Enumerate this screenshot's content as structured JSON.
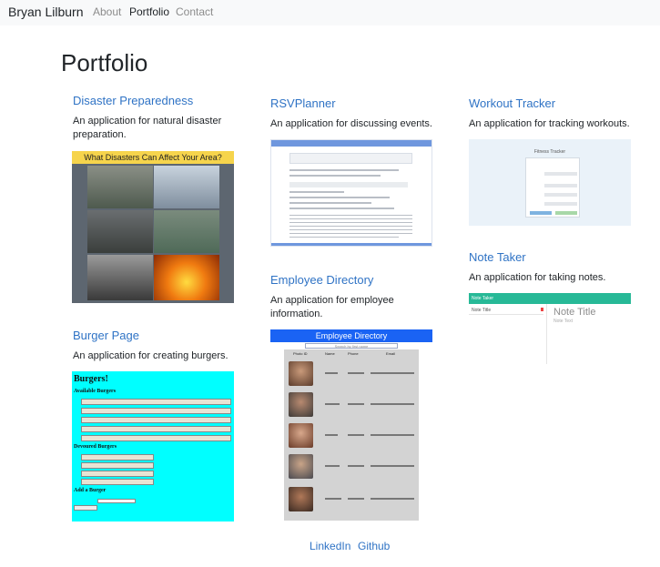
{
  "navbar": {
    "brand": "Bryan Lilburn",
    "links": [
      "About",
      "Portfolio",
      "Contact"
    ]
  },
  "page_title": "Portfolio",
  "projects": [
    {
      "title": "Disaster Preparedness",
      "desc": "An application for natural disaster preparation.",
      "thumb_header": "What Disasters Can Affect Your Area?"
    },
    {
      "title": "RSVPlanner",
      "desc": "An application for discussing events."
    },
    {
      "title": "Workout Tracker",
      "desc": "An application for tracking workouts.",
      "thumb_header": "Fitness Tracker"
    },
    {
      "title": "Note Taker",
      "desc": "An application for taking notes.",
      "thumb_header": "Note Taker",
      "thumb_list_item": "Note Title",
      "thumb_note_title": "Note Title",
      "thumb_note_text": "Note Text"
    },
    {
      "title": "Burger Page",
      "desc": "An application for creating burgers.",
      "thumb_header": "Burgers!",
      "thumb_available": "Available Burgers",
      "thumb_devoured": "Devoured Burgers",
      "thumb_add": "Add a Burger"
    },
    {
      "title": "Employee Directory",
      "desc": "An application for employee information.",
      "thumb_header": "Employee Directory",
      "thumb_search": "Search by first name",
      "thumb_columns": [
        "Photo ID",
        "Name",
        "Phone",
        "Email"
      ]
    }
  ],
  "footer": {
    "links": [
      "LinkedIn",
      "Github"
    ]
  },
  "colors": {
    "link": "#2f73c5",
    "navbar_bg": "#f8f9fa",
    "burger_bg": "#00ffff",
    "employee_bar": "#1a63f4",
    "note_bar": "#27b997"
  }
}
